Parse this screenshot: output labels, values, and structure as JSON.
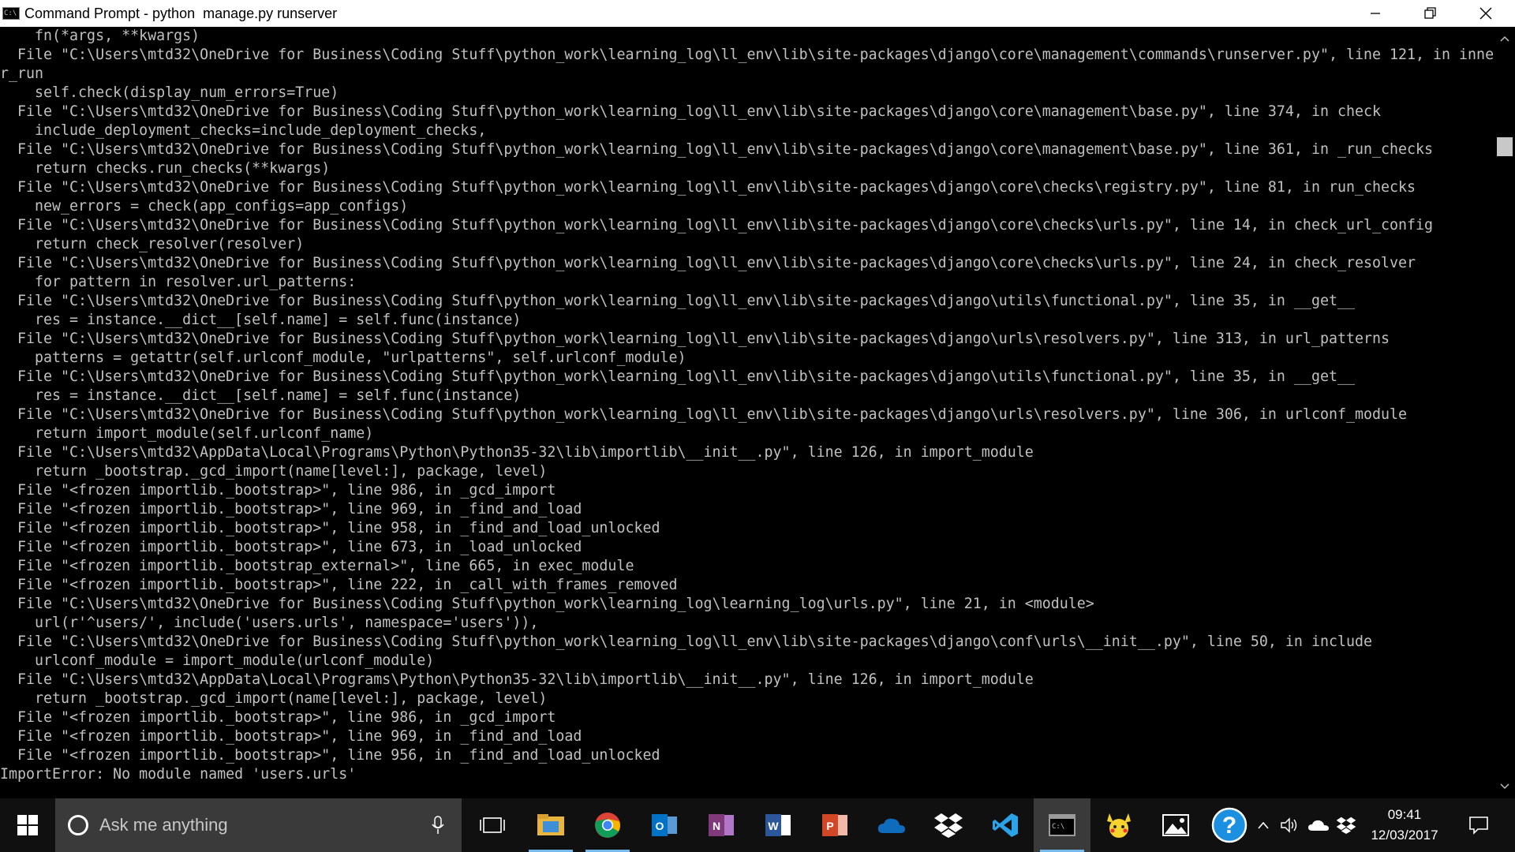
{
  "window": {
    "title": "Command Prompt - python  manage.py runserver",
    "icon": "cmd-icon",
    "icon_text": "C:\\",
    "controls": [
      "minimize-icon",
      "maximize-icon",
      "close-icon"
    ]
  },
  "console": {
    "lines": [
      "    fn(*args, **kwargs)",
      "  File \"C:\\Users\\mtd32\\OneDrive for Business\\Coding Stuff\\python_work\\learning_log\\ll_env\\lib\\site-packages\\django\\core\\management\\commands\\runserver.py\", line 121, in inne",
      "r_run",
      "    self.check(display_num_errors=True)",
      "  File \"C:\\Users\\mtd32\\OneDrive for Business\\Coding Stuff\\python_work\\learning_log\\ll_env\\lib\\site-packages\\django\\core\\management\\base.py\", line 374, in check",
      "    include_deployment_checks=include_deployment_checks,",
      "  File \"C:\\Users\\mtd32\\OneDrive for Business\\Coding Stuff\\python_work\\learning_log\\ll_env\\lib\\site-packages\\django\\core\\management\\base.py\", line 361, in _run_checks",
      "    return checks.run_checks(**kwargs)",
      "  File \"C:\\Users\\mtd32\\OneDrive for Business\\Coding Stuff\\python_work\\learning_log\\ll_env\\lib\\site-packages\\django\\core\\checks\\registry.py\", line 81, in run_checks",
      "    new_errors = check(app_configs=app_configs)",
      "  File \"C:\\Users\\mtd32\\OneDrive for Business\\Coding Stuff\\python_work\\learning_log\\ll_env\\lib\\site-packages\\django\\core\\checks\\urls.py\", line 14, in check_url_config",
      "    return check_resolver(resolver)",
      "  File \"C:\\Users\\mtd32\\OneDrive for Business\\Coding Stuff\\python_work\\learning_log\\ll_env\\lib\\site-packages\\django\\core\\checks\\urls.py\", line 24, in check_resolver",
      "    for pattern in resolver.url_patterns:",
      "  File \"C:\\Users\\mtd32\\OneDrive for Business\\Coding Stuff\\python_work\\learning_log\\ll_env\\lib\\site-packages\\django\\utils\\functional.py\", line 35, in __get__",
      "    res = instance.__dict__[self.name] = self.func(instance)",
      "  File \"C:\\Users\\mtd32\\OneDrive for Business\\Coding Stuff\\python_work\\learning_log\\ll_env\\lib\\site-packages\\django\\urls\\resolvers.py\", line 313, in url_patterns",
      "    patterns = getattr(self.urlconf_module, \"urlpatterns\", self.urlconf_module)",
      "  File \"C:\\Users\\mtd32\\OneDrive for Business\\Coding Stuff\\python_work\\learning_log\\ll_env\\lib\\site-packages\\django\\utils\\functional.py\", line 35, in __get__",
      "    res = instance.__dict__[self.name] = self.func(instance)",
      "  File \"C:\\Users\\mtd32\\OneDrive for Business\\Coding Stuff\\python_work\\learning_log\\ll_env\\lib\\site-packages\\django\\urls\\resolvers.py\", line 306, in urlconf_module",
      "    return import_module(self.urlconf_name)",
      "  File \"C:\\Users\\mtd32\\AppData\\Local\\Programs\\Python\\Python35-32\\lib\\importlib\\__init__.py\", line 126, in import_module",
      "    return _bootstrap._gcd_import(name[level:], package, level)",
      "  File \"<frozen importlib._bootstrap>\", line 986, in _gcd_import",
      "  File \"<frozen importlib._bootstrap>\", line 969, in _find_and_load",
      "  File \"<frozen importlib._bootstrap>\", line 958, in _find_and_load_unlocked",
      "  File \"<frozen importlib._bootstrap>\", line 673, in _load_unlocked",
      "  File \"<frozen importlib._bootstrap_external>\", line 665, in exec_module",
      "  File \"<frozen importlib._bootstrap>\", line 222, in _call_with_frames_removed",
      "  File \"C:\\Users\\mtd32\\OneDrive for Business\\Coding Stuff\\python_work\\learning_log\\learning_log\\urls.py\", line 21, in <module>",
      "    url(r'^users/', include('users.urls', namespace='users')),",
      "  File \"C:\\Users\\mtd32\\OneDrive for Business\\Coding Stuff\\python_work\\learning_log\\ll_env\\lib\\site-packages\\django\\conf\\urls\\__init__.py\", line 50, in include",
      "    urlconf_module = import_module(urlconf_module)",
      "  File \"C:\\Users\\mtd32\\AppData\\Local\\Programs\\Python\\Python35-32\\lib\\importlib\\__init__.py\", line 126, in import_module",
      "    return _bootstrap._gcd_import(name[level:], package, level)",
      "  File \"<frozen importlib._bootstrap>\", line 986, in _gcd_import",
      "  File \"<frozen importlib._bootstrap>\", line 969, in _find_and_load",
      "  File \"<frozen importlib._bootstrap>\", line 956, in _find_and_load_unlocked",
      "ImportError: No module named 'users.urls'"
    ]
  },
  "taskbar": {
    "search_placeholder": "Ask me anything",
    "apps": [
      {
        "name": "task-view-icon"
      },
      {
        "name": "file-explorer-icon"
      },
      {
        "name": "chrome-icon"
      },
      {
        "name": "outlook-icon"
      },
      {
        "name": "onenote-icon"
      },
      {
        "name": "word-icon"
      },
      {
        "name": "powerpoint-icon"
      },
      {
        "name": "onedrive-icon"
      },
      {
        "name": "dropbox-icon"
      },
      {
        "name": "vscode-icon"
      },
      {
        "name": "command-prompt-icon"
      },
      {
        "name": "pikachu-app-icon"
      },
      {
        "name": "photos-icon"
      },
      {
        "name": "help-icon"
      }
    ],
    "tray": [
      "chevron-up-icon",
      "volume-icon",
      "onedrive-tray-icon",
      "dropbox-tray-icon"
    ],
    "clock_time": "09:41",
    "clock_date": "12/03/2017"
  },
  "colors": {
    "console_bg": "#000000",
    "console_fg": "#c0c0c0",
    "taskbar_bg": "#101010",
    "accent": "#76b9ed"
  }
}
